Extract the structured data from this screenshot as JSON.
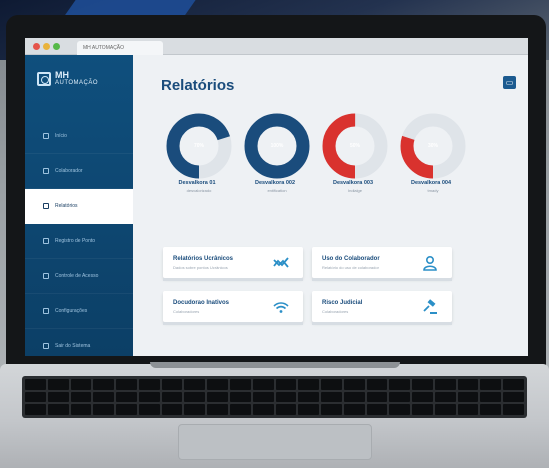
{
  "browser": {
    "tab_title": "MH AUTOMAÇÃO"
  },
  "brand": {
    "name": "MH",
    "subtitle": "AUTOMAÇÃO",
    "accent_color": "#0f4f7d",
    "title_color": "#1a4c7c"
  },
  "sidebar": {
    "items": [
      {
        "label": "Início",
        "icon": "home-icon",
        "active": false
      },
      {
        "label": "Colaborador",
        "icon": "pencil-icon",
        "active": false
      },
      {
        "label": "Relatórios",
        "icon": "report-icon",
        "active": true
      },
      {
        "label": "Registro de Ponto",
        "icon": "clock-icon",
        "active": false
      },
      {
        "label": "Controle de Acesso",
        "icon": "lock-icon",
        "active": false
      },
      {
        "label": "Configurações",
        "icon": "gear-icon",
        "active": false
      },
      {
        "label": "Sair do Sistema",
        "icon": "exit-icon",
        "active": false
      }
    ]
  },
  "main": {
    "title": "Relatórios",
    "corner_button": "▭"
  },
  "gauges": [
    {
      "label": "Desvalkora 01",
      "sub": "desvalorizado",
      "percent": 70,
      "percent_label": "70%",
      "color": "#1a4c7c"
    },
    {
      "label": "Desvalkora 002",
      "sub": "entification",
      "percent": 100,
      "percent_label": "100%",
      "color": "#1a4c7c"
    },
    {
      "label": "Desvalkora 003",
      "sub": "Indialge",
      "percent": 50,
      "percent_label": "50%",
      "color": "#d9322e"
    },
    {
      "label": "Desvalkora 004",
      "sub": "tmady",
      "percent": 30,
      "percent_label": "30%",
      "color": "#d9322e"
    }
  ],
  "cards": [
    {
      "title": "Relatórios Ucrânicos",
      "sub": "Dados sobre pontos Ucrânicos",
      "icon": "chart-arrows-icon"
    },
    {
      "title": "Uso do Colaborador",
      "sub": "Relatório do uso de colaborador",
      "icon": "user-icon"
    },
    {
      "title": "Docudorao Inativos",
      "sub": "Colaboradores",
      "icon": "wifi-icon"
    },
    {
      "title": "Risco Judicial",
      "sub": "Colaboradores",
      "icon": "gavel-icon"
    }
  ]
}
